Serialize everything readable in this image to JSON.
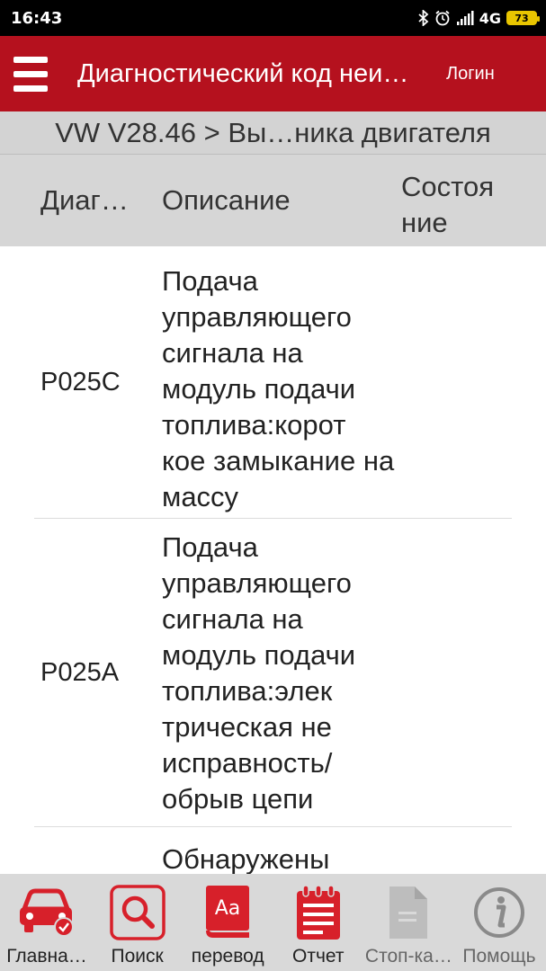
{
  "status_bar": {
    "time": "16:43",
    "network": "4G",
    "battery": "73"
  },
  "app_bar": {
    "title": "Диагностический код неи…",
    "login_label": "Логин",
    "accent": "#b5111e"
  },
  "breadcrumb": {
    "text": "VW V28.46 > Вы…ника двигателя"
  },
  "table": {
    "headers": {
      "code": "Диаг…",
      "description": "Описание",
      "state_line1": "Состоя",
      "state_line2": "ние"
    },
    "rows": [
      {
        "code": "P025C",
        "description": "Подача управляющего сигнала на модуль подачи топлива:корот кое замыкание на массу",
        "state": ""
      },
      {
        "code": "P025A",
        "description": "Подача управляющего сигнала на модуль подачи топлива:элек трическая не исправность/ обрыв цепи",
        "state": ""
      },
      {
        "code": "",
        "description": "Обнаружены",
        "state": ""
      }
    ]
  },
  "bottom_nav": [
    {
      "label": "Главна…",
      "icon": "car-check-icon"
    },
    {
      "label": "Поиск",
      "icon": "search-icon"
    },
    {
      "label": "перевод",
      "icon": "dictionary-icon"
    },
    {
      "label": "Отчет",
      "icon": "report-icon"
    },
    {
      "label": "Стоп-ка…",
      "icon": "document-icon",
      "disabled": true
    },
    {
      "label": "Помощь",
      "icon": "info-icon",
      "disabled": true
    }
  ]
}
